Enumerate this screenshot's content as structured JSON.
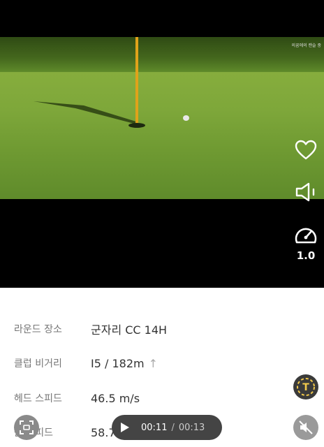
{
  "video": {
    "watermark": "의꿈에의 캔슬 중 ",
    "speed": "1.0",
    "icons": {
      "like": "heart-icon",
      "volume": "speaker-icon",
      "speed": "speedometer-icon"
    }
  },
  "shot_info": {
    "rows": [
      {
        "label": "라운드 장소",
        "value": "군자리 CC 14H"
      },
      {
        "label": "클럽 비거리",
        "value": "I5 / 182m"
      },
      {
        "label": "헤드 스피드",
        "value": "46.5 m/s"
      },
      {
        "label": "볼 스피드",
        "value": "58.7 m/s"
      }
    ]
  },
  "player": {
    "current": "00:11",
    "separator": "/",
    "duration": "00:13"
  },
  "colors": {
    "text_icon_accent": "#f2c94c",
    "pin": "#e0a21a"
  }
}
